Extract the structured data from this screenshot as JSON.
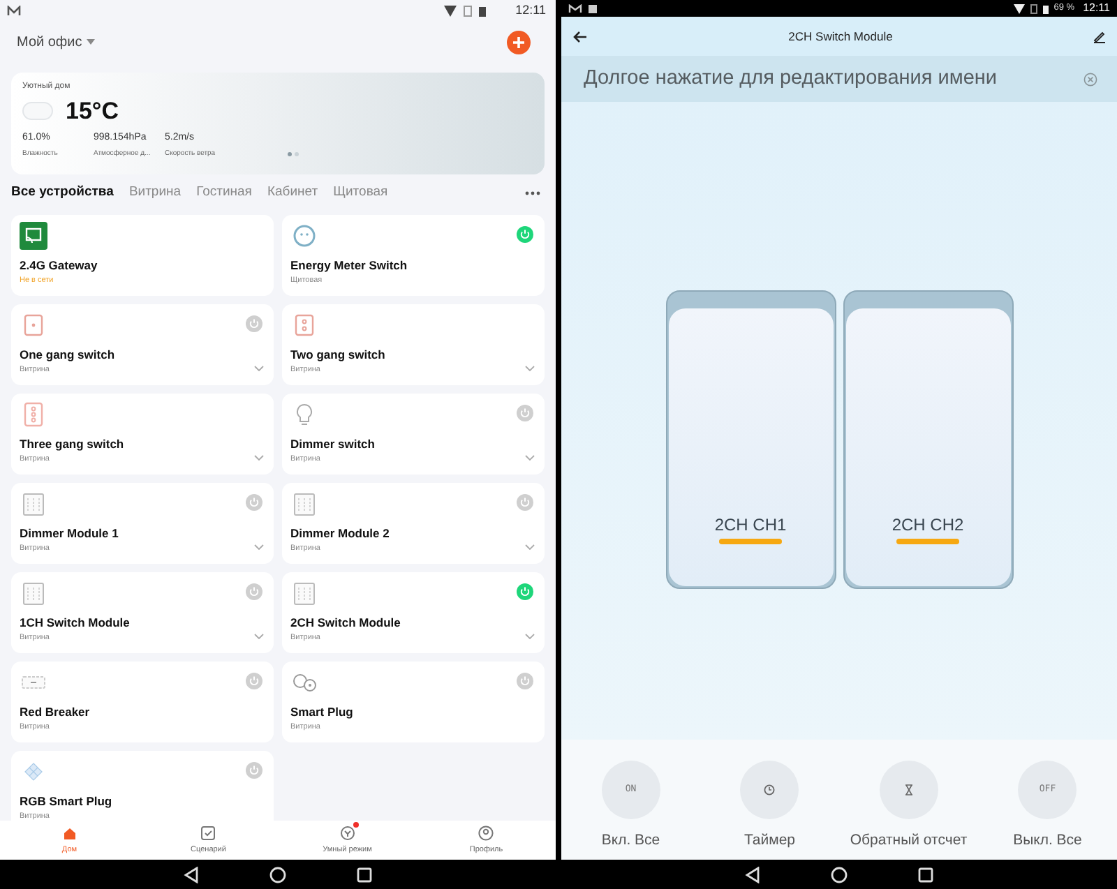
{
  "left_status_bar": {
    "time": "12:11"
  },
  "home": {
    "title": "Мой офис"
  },
  "weather": {
    "place": "Уютный дом",
    "temperature": "15°C",
    "stats": [
      {
        "value": "61.0%",
        "label": "Влажность"
      },
      {
        "value": "998.154hPa",
        "label": "Атмосферное д..."
      },
      {
        "value": "5.2m/s",
        "label": "Скорость ветра"
      }
    ],
    "pages": [
      {
        "selected": true
      },
      {
        "selected": false
      }
    ]
  },
  "tabs": [
    {
      "label": "Все устройства",
      "selected": true
    },
    {
      "label": "Витрина",
      "selected": false
    },
    {
      "label": "Гостиная",
      "selected": false
    },
    {
      "label": "Кабинет",
      "selected": false
    },
    {
      "label": "Щитовая",
      "selected": false
    }
  ],
  "devices": [
    {
      "name": "2.4G Gateway",
      "room": "Не в сети",
      "offline": true,
      "kind": "gateway",
      "expandable": false
    },
    {
      "name": "Energy Meter Switch",
      "room": "Щитовая",
      "offline": false,
      "kind": "meter",
      "on": true,
      "expandable": false
    },
    {
      "name": "One gang switch",
      "room": "Витрина",
      "offline": false,
      "kind": "gang1",
      "on": false,
      "expandable": true
    },
    {
      "name": "Two gang switch",
      "room": "Витрина",
      "offline": false,
      "kind": "gang2",
      "expandable": true
    },
    {
      "name": "Three gang switch",
      "room": "Витрина",
      "offline": false,
      "kind": "gang3",
      "expandable": true
    },
    {
      "name": "Dimmer switch",
      "room": "Витрина",
      "offline": false,
      "kind": "bulb",
      "on": false,
      "expandable": true
    },
    {
      "name": "Dimmer Module 1",
      "room": "Витрина",
      "offline": false,
      "kind": "module",
      "on": false,
      "expandable": true
    },
    {
      "name": "Dimmer Module 2",
      "room": "Витрина",
      "offline": false,
      "kind": "module",
      "on": false,
      "expandable": true
    },
    {
      "name": "1CH Switch Module",
      "room": "Витрина",
      "offline": false,
      "kind": "module",
      "on": false,
      "expandable": true
    },
    {
      "name": "2CH Switch Module",
      "room": "Витрина",
      "offline": false,
      "kind": "module",
      "on": true,
      "expandable": true
    },
    {
      "name": "Red Breaker",
      "room": "Витрина",
      "offline": false,
      "kind": "breaker",
      "on": false,
      "expandable": false
    },
    {
      "name": "Smart Plug",
      "room": "Витрина",
      "offline": false,
      "kind": "plug",
      "on": false,
      "expandable": false
    },
    {
      "name": "RGB Smart Plug",
      "room": "Витрина",
      "offline": false,
      "kind": "rgb",
      "on": false,
      "expandable": false
    }
  ],
  "bottom_nav": [
    {
      "label": "Дом",
      "kind": "home",
      "selected": true,
      "badge": false
    },
    {
      "label": "Сценарий",
      "kind": "scene",
      "selected": false,
      "badge": false
    },
    {
      "label": "Умный режим",
      "kind": "smart",
      "selected": false,
      "badge": true
    },
    {
      "label": "Профиль",
      "kind": "profile",
      "selected": false,
      "badge": false
    }
  ],
  "right_status_bar": {
    "battery": "69 %",
    "time": "12:11"
  },
  "device_page": {
    "title": "2CH Switch Module",
    "hint": "Долгое нажатие для редактирования имени",
    "channels": [
      {
        "label": "2CH CH1"
      },
      {
        "label": "2CH CH2"
      }
    ],
    "actions": [
      {
        "kind": "text",
        "icon_text": "ON",
        "label": "Вкл. Все"
      },
      {
        "kind": "timer",
        "label": "Таймер"
      },
      {
        "kind": "countdown",
        "label": "Обратный отсчет"
      },
      {
        "kind": "text",
        "icon_text": "OFF",
        "label": "Выкл. Все"
      }
    ]
  }
}
